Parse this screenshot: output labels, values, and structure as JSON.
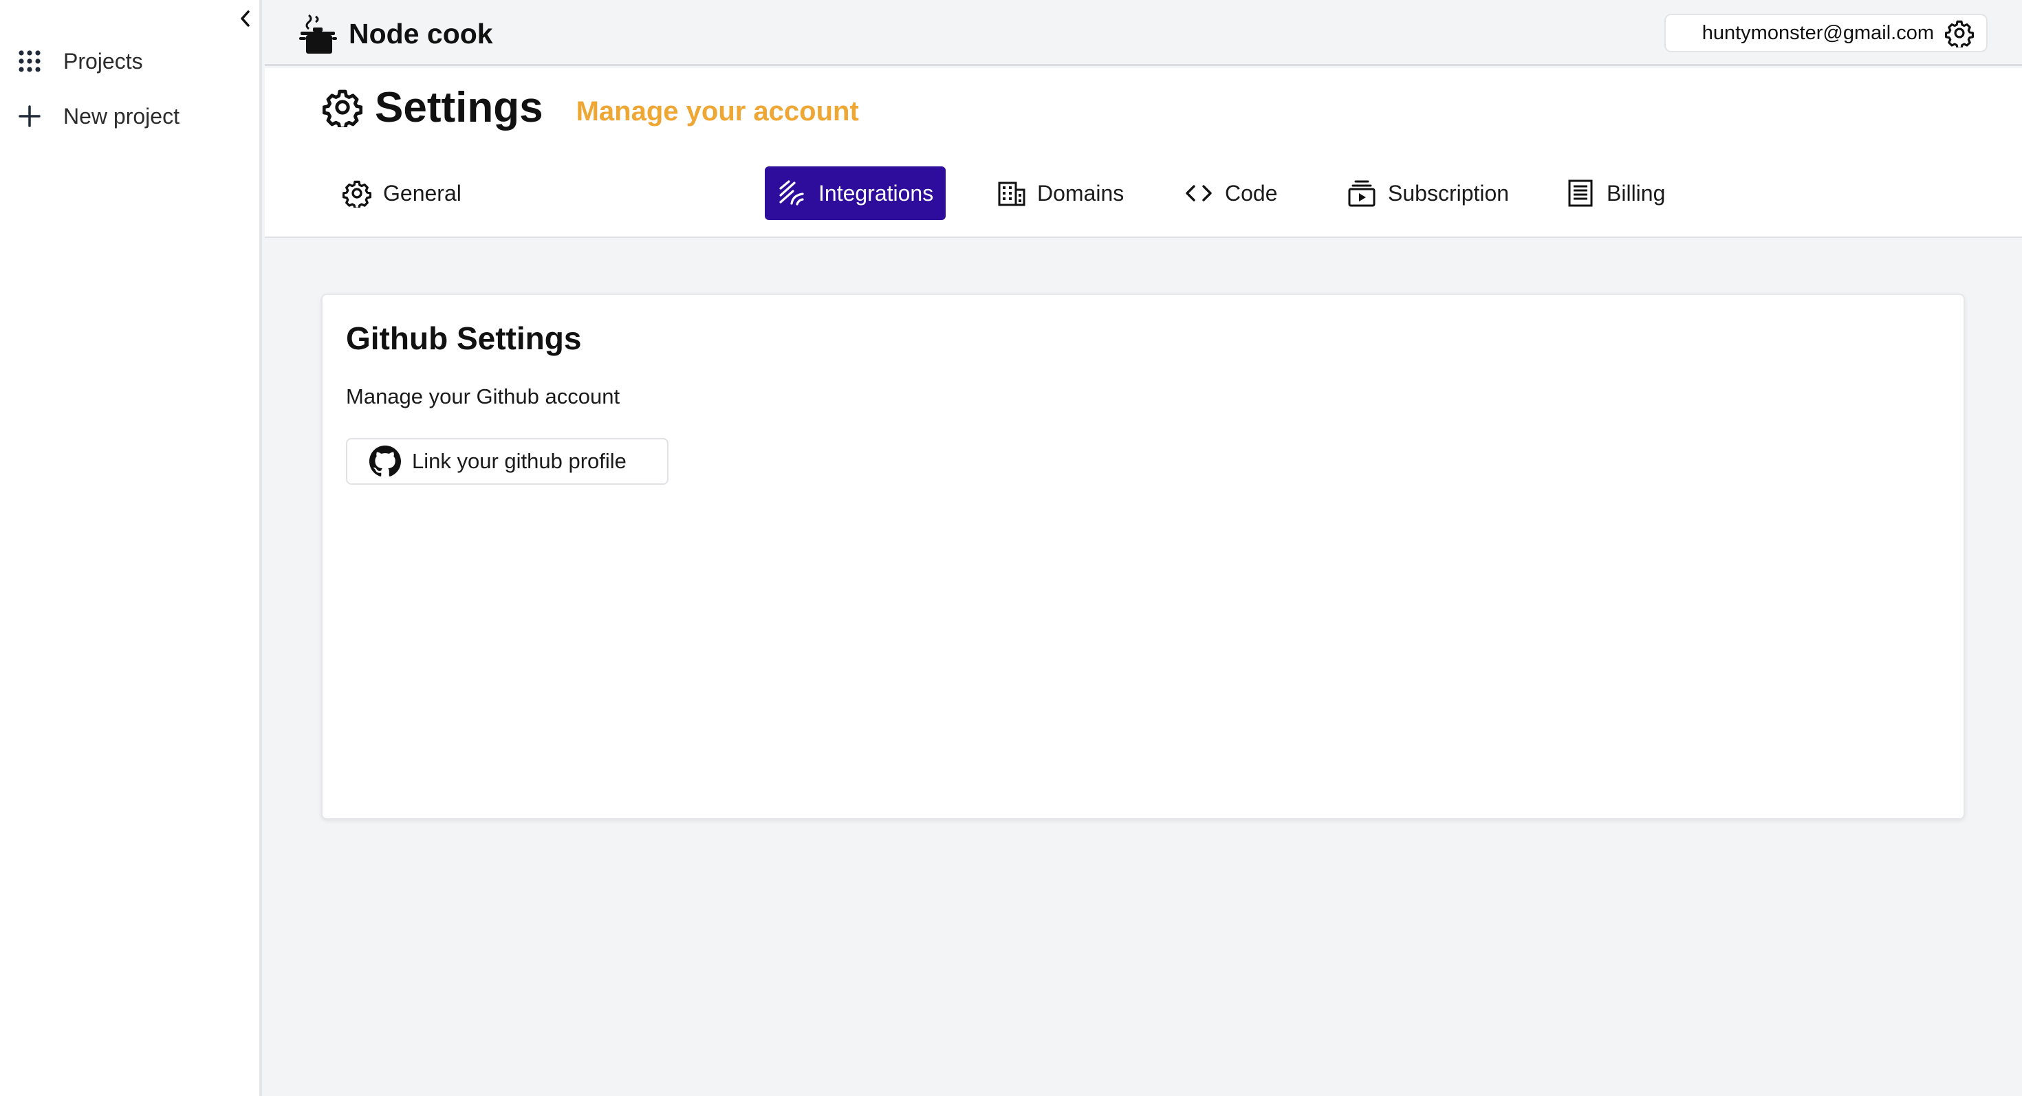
{
  "sidebar": {
    "collapse_icon": "chevron-left-icon",
    "items": [
      {
        "label": "Projects",
        "icon": "grid-dots-icon"
      },
      {
        "label": "New project",
        "icon": "plus-icon"
      }
    ]
  },
  "topbar": {
    "brand": "Node cook",
    "account_email": "huntymonster@gmail.com",
    "account_icon": "gear-icon"
  },
  "header": {
    "title": "Settings",
    "subtitle": "Manage your account",
    "subtitle_color": "#eea735"
  },
  "tabs": [
    {
      "label": "General",
      "icon": "gear-icon",
      "active": false
    },
    {
      "label": "Integrations",
      "icon": "signal-waves-icon",
      "active": true
    },
    {
      "label": "Domains",
      "icon": "building-icon",
      "active": false
    },
    {
      "label": "Code",
      "icon": "code-brackets-icon",
      "active": false
    },
    {
      "label": "Subscription",
      "icon": "subscription-icon",
      "active": false
    },
    {
      "label": "Billing",
      "icon": "receipt-icon",
      "active": false
    }
  ],
  "active_tab_color": "#2e0c9c",
  "card": {
    "title": "Github Settings",
    "description": "Manage your Github account",
    "button_label": "Link your github profile",
    "button_icon": "github-icon"
  }
}
